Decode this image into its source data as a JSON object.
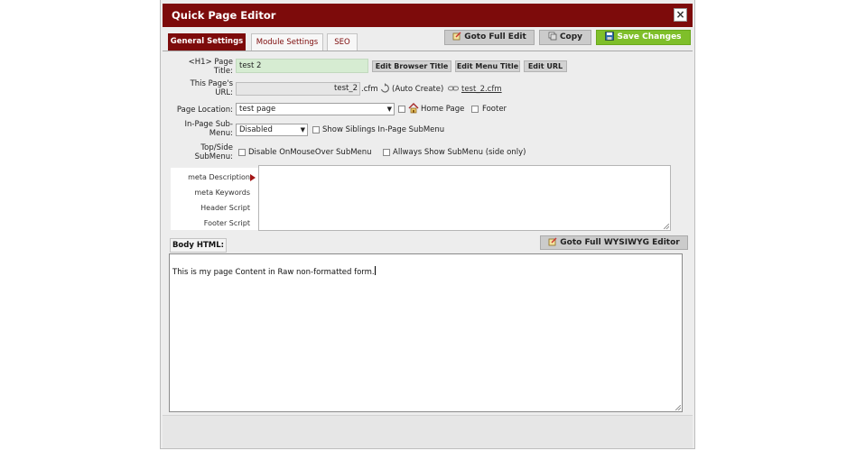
{
  "dialog": {
    "title": "Quick Page Editor",
    "close_label": "×"
  },
  "tabs": [
    {
      "label": "General Settings",
      "active": true
    },
    {
      "label": "Module Settings",
      "active": false
    },
    {
      "label": "SEO",
      "active": false
    }
  ],
  "header_buttons": {
    "goto_full_edit": "Goto Full Edit",
    "copy": "Copy",
    "save_changes": "Save Changes"
  },
  "h1_title": {
    "label_line1": "<H1> Page",
    "label_line2": "Title:",
    "value": "test 2",
    "edit_browser_title": "Edit Browser Title",
    "edit_menu_title": "Edit Menu Title",
    "edit_url": "Edit URL"
  },
  "url": {
    "label_line1": "This Page's",
    "label_line2": "URL:",
    "value": "test_2",
    "suffix": ".cfm",
    "auto_create": "(Auto Create)",
    "link_text": "test_2.cfm"
  },
  "location": {
    "label": "Page Location:",
    "selected": "test page",
    "home_page": "Home Page",
    "footer": "Footer"
  },
  "submenu": {
    "label_line1": "In-Page Sub-",
    "label_line2": "Menu:",
    "selected": "Disabled",
    "show_siblings": "Show Siblings In-Page SubMenu"
  },
  "topside": {
    "label_line1": "Top/Side",
    "label_line2": "SubMenu:",
    "disable_mouseover": "Disable OnMouseOver SubMenu",
    "always_show": "Allways Show SubMenu (side only)"
  },
  "meta_nav": {
    "items": [
      "meta Description",
      "meta Keywords",
      "Header Script",
      "Footer Script"
    ]
  },
  "body": {
    "tab_label": "Body HTML:",
    "wysiwyg_button": "Goto Full WYSIWYG Editor",
    "content": "This is my page Content in Raw non-formatted form."
  },
  "colors": {
    "brand": "#7d0b0b",
    "save_green": "#7fbf2a",
    "title_field": "#d6ecd2"
  }
}
